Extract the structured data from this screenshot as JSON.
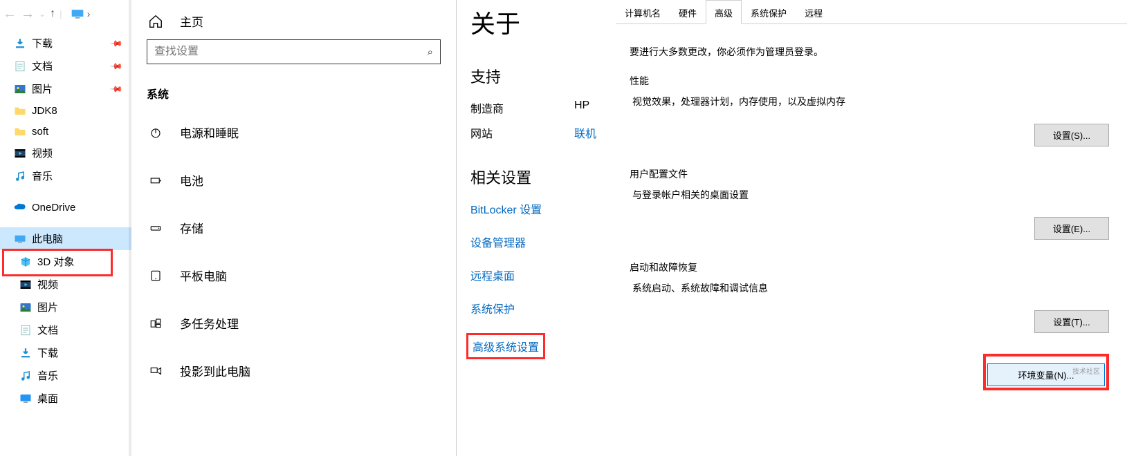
{
  "explorer": {
    "tree": [
      {
        "name": "下载",
        "icon": "download",
        "pin": true
      },
      {
        "name": "文档",
        "icon": "doc",
        "pin": true
      },
      {
        "name": "图片",
        "icon": "pic",
        "pin": true
      },
      {
        "name": "JDK8",
        "icon": "folder",
        "pin": false
      },
      {
        "name": "soft",
        "icon": "folder",
        "pin": false
      },
      {
        "name": "视频",
        "icon": "video",
        "pin": false
      },
      {
        "name": "音乐",
        "icon": "music",
        "pin": false
      }
    ],
    "onedrive": "OneDrive",
    "thispc": "此电脑",
    "pcTree": [
      {
        "name": "3D 对象",
        "icon": "3d"
      },
      {
        "name": "视频",
        "icon": "video"
      },
      {
        "name": "图片",
        "icon": "pic"
      },
      {
        "name": "文档",
        "icon": "doc"
      },
      {
        "name": "下载",
        "icon": "download"
      },
      {
        "name": "音乐",
        "icon": "music"
      },
      {
        "name": "桌面",
        "icon": "desktop"
      }
    ]
  },
  "settings": {
    "home": "主页",
    "searchPlaceholder": "查找设置",
    "systemLabel": "系统",
    "items": [
      {
        "label": "电源和睡眠",
        "icon": "power"
      },
      {
        "label": "电池",
        "icon": "battery"
      },
      {
        "label": "存储",
        "icon": "storage"
      },
      {
        "label": "平板电脑",
        "icon": "tablet"
      },
      {
        "label": "多任务处理",
        "icon": "multitask"
      },
      {
        "label": "投影到此电脑",
        "icon": "project"
      }
    ]
  },
  "about": {
    "title": "关于",
    "supportTitle": "支持",
    "rows": [
      {
        "k": "制造商",
        "v": "HP",
        "link": false
      },
      {
        "k": "网站",
        "v": "联机",
        "link": true
      }
    ],
    "relatedTitle": "相关设置",
    "links": [
      "BitLocker 设置",
      "设备管理器",
      "远程桌面",
      "系统保护",
      "高级系统设置"
    ]
  },
  "sysprop": {
    "tabs": [
      "计算机名",
      "硬件",
      "高级",
      "系统保护",
      "远程"
    ],
    "activeTab": 2,
    "adminNote": "要进行大多数更改，你必须作为管理员登录。",
    "groups": [
      {
        "legend": "性能",
        "desc": "视觉效果，处理器计划，内存使用，以及虚拟内存",
        "btn": "设置(S)..."
      },
      {
        "legend": "用户配置文件",
        "desc": "与登录帐户相关的桌面设置",
        "btn": "设置(E)..."
      },
      {
        "legend": "启动和故障恢复",
        "desc": "系统启动、系统故障和调试信息",
        "btn": "设置(T)..."
      }
    ],
    "envBtn": "环境变量(N)...",
    "watermark": "技术社区"
  }
}
